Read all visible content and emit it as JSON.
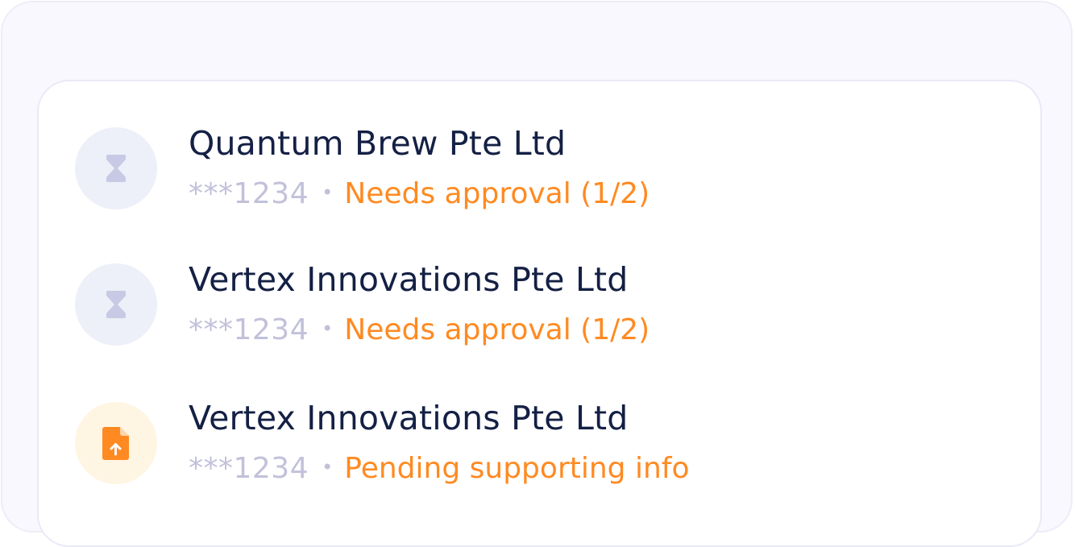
{
  "accounts": [
    {
      "name": "Quantum Brew Pte Ltd",
      "account": "***1234",
      "separator": "•",
      "status": "Needs approval (1/2)",
      "icon": "hourglass-icon",
      "status_color": "#ff8a21"
    },
    {
      "name": "Vertex Innovations Pte Ltd",
      "account": "***1234",
      "separator": "•",
      "status": "Needs approval (1/2)",
      "icon": "hourglass-icon",
      "status_color": "#ff8a21"
    },
    {
      "name": "Vertex Innovations Pte Ltd",
      "account": "***1234",
      "separator": "•",
      "status": "Pending supporting info",
      "icon": "file-upload-icon",
      "status_color": "#ff8a21"
    }
  ]
}
